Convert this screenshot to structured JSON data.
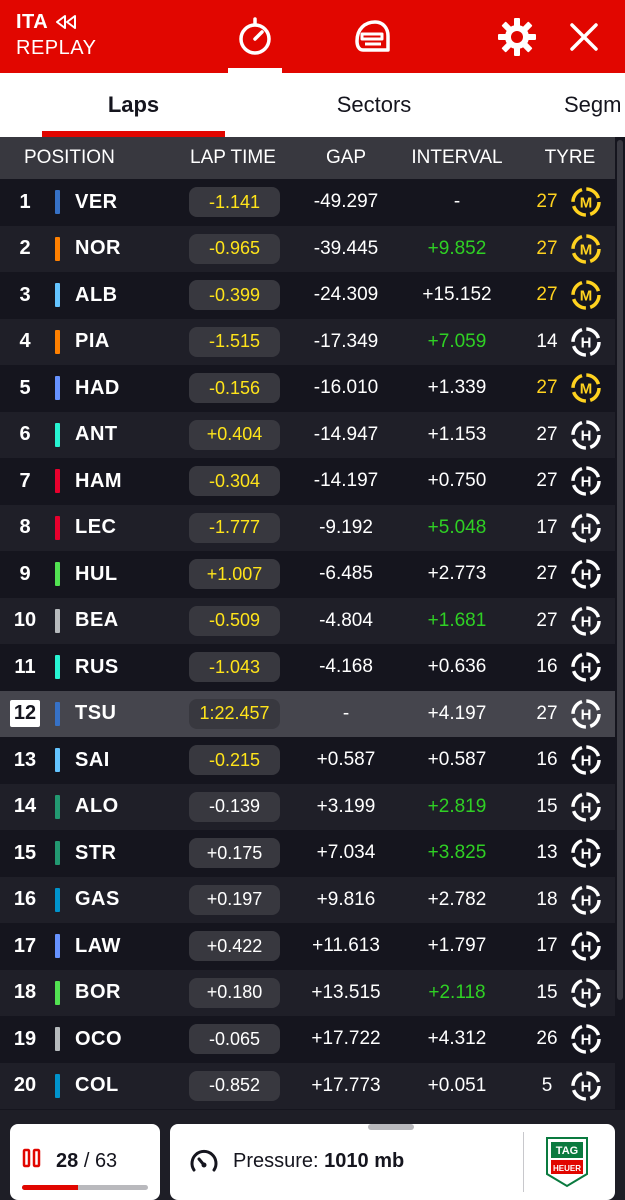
{
  "header": {
    "race": "ITA",
    "mode": "REPLAY",
    "icons": [
      "rewind-icon",
      "timer-icon",
      "helmet-icon",
      "gear-icon",
      "close-icon"
    ],
    "color": "#e10600"
  },
  "tabs": [
    {
      "label": "Laps",
      "active": true
    },
    {
      "label": "Sectors",
      "active": false
    },
    {
      "label": "Segm",
      "active": false
    }
  ],
  "columns": {
    "position": "POSITION",
    "lap_time": "LAP TIME",
    "gap": "GAP",
    "interval": "INTERVAL",
    "tyre": "TYRE"
  },
  "colors": {
    "yellow": "#ffe41a",
    "green": "#2fd024",
    "accent": "#e10600"
  },
  "rows": [
    {
      "pos": "1",
      "code": "VER",
      "team": "#3671c6",
      "lap": "-1.141",
      "lap_y": true,
      "gap": "-49.297",
      "int": "-",
      "int_g": false,
      "age": "27",
      "age_y": true,
      "tyre": "M"
    },
    {
      "pos": "2",
      "code": "NOR",
      "team": "#ff8000",
      "lap": "-0.965",
      "lap_y": true,
      "gap": "-39.445",
      "int": "+9.852",
      "int_g": true,
      "age": "27",
      "age_y": true,
      "tyre": "M"
    },
    {
      "pos": "3",
      "code": "ALB",
      "team": "#64c4ff",
      "lap": "-0.399",
      "lap_y": true,
      "gap": "-24.309",
      "int": "+15.152",
      "int_g": false,
      "age": "27",
      "age_y": true,
      "tyre": "M"
    },
    {
      "pos": "4",
      "code": "PIA",
      "team": "#ff8000",
      "lap": "-1.515",
      "lap_y": true,
      "gap": "-17.349",
      "int": "+7.059",
      "int_g": true,
      "age": "14",
      "age_y": false,
      "tyre": "H"
    },
    {
      "pos": "5",
      "code": "HAD",
      "team": "#6692ff",
      "lap": "-0.156",
      "lap_y": true,
      "gap": "-16.010",
      "int": "+1.339",
      "int_g": false,
      "age": "27",
      "age_y": true,
      "tyre": "M"
    },
    {
      "pos": "6",
      "code": "ANT",
      "team": "#27f4d2",
      "lap": "+0.404",
      "lap_y": true,
      "gap": "-14.947",
      "int": "+1.153",
      "int_g": false,
      "age": "27",
      "age_y": false,
      "tyre": "H"
    },
    {
      "pos": "7",
      "code": "HAM",
      "team": "#e8002d",
      "lap": "-0.304",
      "lap_y": true,
      "gap": "-14.197",
      "int": "+0.750",
      "int_g": false,
      "age": "27",
      "age_y": false,
      "tyre": "H"
    },
    {
      "pos": "8",
      "code": "LEC",
      "team": "#e8002d",
      "lap": "-1.777",
      "lap_y": true,
      "gap": "-9.192",
      "int": "+5.048",
      "int_g": true,
      "age": "17",
      "age_y": false,
      "tyre": "H"
    },
    {
      "pos": "9",
      "code": "HUL",
      "team": "#52e252",
      "lap": "+1.007",
      "lap_y": true,
      "gap": "-6.485",
      "int": "+2.773",
      "int_g": false,
      "age": "27",
      "age_y": false,
      "tyre": "H"
    },
    {
      "pos": "10",
      "code": "BEA",
      "team": "#b6babd",
      "lap": "-0.509",
      "lap_y": true,
      "gap": "-4.804",
      "int": "+1.681",
      "int_g": true,
      "age": "27",
      "age_y": false,
      "tyre": "H"
    },
    {
      "pos": "11",
      "code": "RUS",
      "team": "#27f4d2",
      "lap": "-1.043",
      "lap_y": true,
      "gap": "-4.168",
      "int": "+0.636",
      "int_g": false,
      "age": "16",
      "age_y": false,
      "tyre": "H"
    },
    {
      "pos": "12",
      "code": "TSU",
      "team": "#3671c6",
      "lap": "1:22.457",
      "lap_y": true,
      "gap": "-",
      "int": "+4.197",
      "int_g": false,
      "age": "27",
      "age_y": false,
      "tyre": "H",
      "highlight": true
    },
    {
      "pos": "13",
      "code": "SAI",
      "team": "#64c4ff",
      "lap": "-0.215",
      "lap_y": true,
      "gap": "+0.587",
      "int": "+0.587",
      "int_g": false,
      "age": "16",
      "age_y": false,
      "tyre": "H"
    },
    {
      "pos": "14",
      "code": "ALO",
      "team": "#229971",
      "lap": "-0.139",
      "lap_y": false,
      "gap": "+3.199",
      "int": "+2.819",
      "int_g": true,
      "age": "15",
      "age_y": false,
      "tyre": "H"
    },
    {
      "pos": "15",
      "code": "STR",
      "team": "#229971",
      "lap": "+0.175",
      "lap_y": false,
      "gap": "+7.034",
      "int": "+3.825",
      "int_g": true,
      "age": "13",
      "age_y": false,
      "tyre": "H"
    },
    {
      "pos": "16",
      "code": "GAS",
      "team": "#0093cc",
      "lap": "+0.197",
      "lap_y": false,
      "gap": "+9.816",
      "int": "+2.782",
      "int_g": false,
      "age": "18",
      "age_y": false,
      "tyre": "H"
    },
    {
      "pos": "17",
      "code": "LAW",
      "team": "#6692ff",
      "lap": "+0.422",
      "lap_y": false,
      "gap": "+11.613",
      "int": "+1.797",
      "int_g": false,
      "age": "17",
      "age_y": false,
      "tyre": "H"
    },
    {
      "pos": "18",
      "code": "BOR",
      "team": "#52e252",
      "lap": "+0.180",
      "lap_y": false,
      "gap": "+13.515",
      "int": "+2.118",
      "int_g": true,
      "age": "15",
      "age_y": false,
      "tyre": "H"
    },
    {
      "pos": "19",
      "code": "OCO",
      "team": "#b6babd",
      "lap": "-0.065",
      "lap_y": false,
      "gap": "+17.722",
      "int": "+4.312",
      "int_g": false,
      "age": "26",
      "age_y": false,
      "tyre": "H"
    },
    {
      "pos": "20",
      "code": "COL",
      "team": "#0093cc",
      "lap": "-0.852",
      "lap_y": false,
      "gap": "+17.773",
      "int": "+0.051",
      "int_g": false,
      "age": "5",
      "age_y": false,
      "tyre": "H"
    }
  ],
  "footer": {
    "lap_current": "28",
    "lap_separator": "/",
    "lap_total": "63",
    "lap_progress": 0.444,
    "pressure_label": "Pressure:",
    "pressure_value": "1010 mb",
    "icons": [
      "pause-icon",
      "gauge-icon",
      "tag-heuer-logo"
    ],
    "sponsor": "TAG HEUER"
  }
}
